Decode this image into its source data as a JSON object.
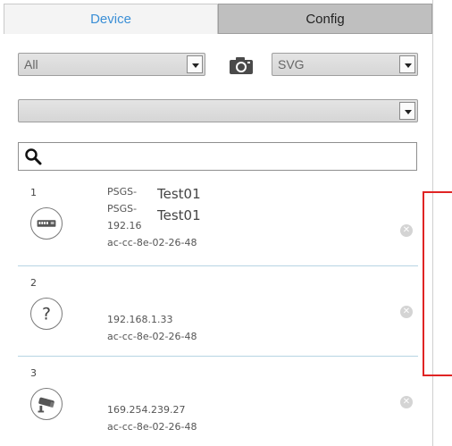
{
  "tabs": [
    {
      "label": "Device"
    },
    {
      "label": "Config"
    }
  ],
  "filters": {
    "type_value": "All",
    "format_value": "SVG",
    "secondary_value": ""
  },
  "search": {
    "value": "",
    "placeholder": ""
  },
  "devices": [
    {
      "index": "1",
      "icon": "switch-icon",
      "name1": "PSGS-",
      "name2": "PSGS-",
      "ip": "192.16",
      "mac": "ac-cc-8e-02-26-48",
      "overlay1": "Test01",
      "overlay2": "Test01"
    },
    {
      "index": "2",
      "icon": "unknown-device-icon",
      "ip": "192.168.1.33",
      "mac": "ac-cc-8e-02-26-48"
    },
    {
      "index": "3",
      "icon": "camera-device-icon",
      "ip": "169.254.239.27",
      "mac": "ac-cc-8e-02-26-48"
    }
  ],
  "colors": {
    "active_tab_text": "#3b8fd6",
    "annotation": "#e02424"
  }
}
